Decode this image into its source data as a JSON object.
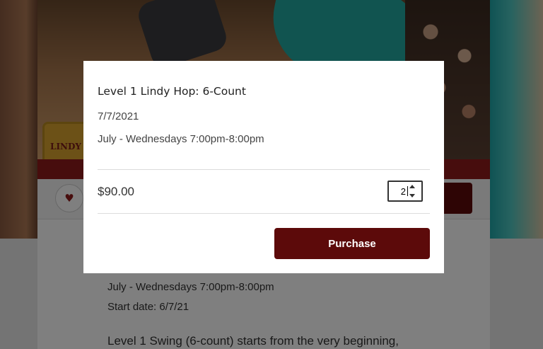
{
  "background": {
    "logo_text": "LINDY",
    "favorite_icon": "heart-icon",
    "schedule": "July - Wednesdays 7:00pm-8:00pm",
    "start_date": "Start date: 6/7/21",
    "description": "Level 1 Swing (6-count) starts from the very beginning,"
  },
  "modal": {
    "title": "Level 1 Lindy Hop: 6-Count",
    "date": "7/7/2021",
    "schedule": "July - Wednesdays 7:00pm-8:00pm",
    "price": "$90.00",
    "quantity": "2",
    "purchase_label": "Purchase"
  },
  "colors": {
    "accent": "#5c0a0a",
    "band": "#8f1b1b"
  }
}
